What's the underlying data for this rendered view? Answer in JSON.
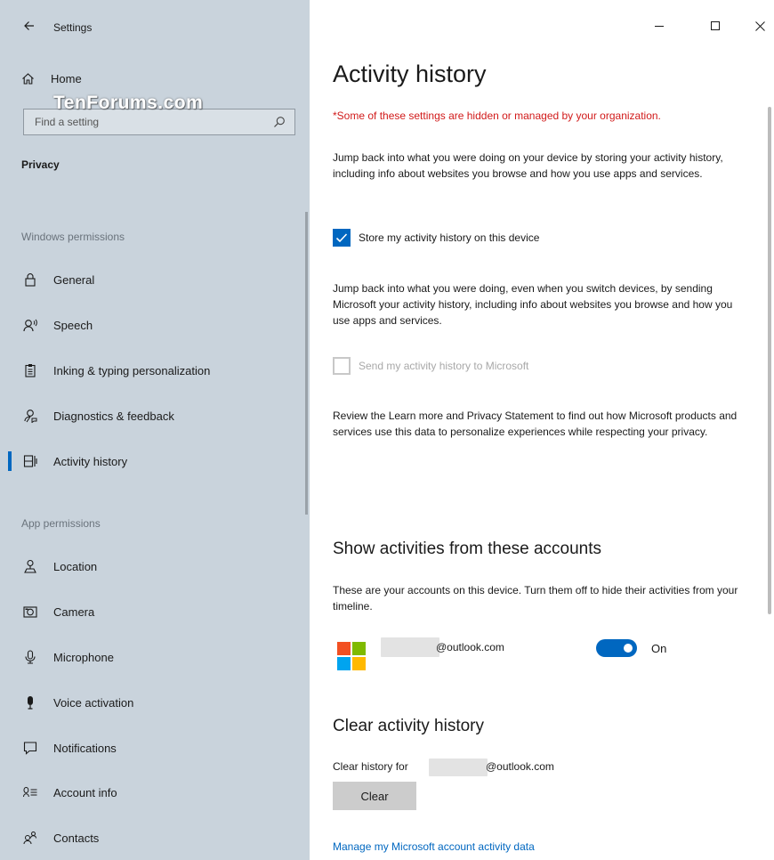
{
  "window": {
    "title": "Settings",
    "watermark": "TenForums.com",
    "controls": {
      "minimize": "–",
      "maximize": "☐",
      "close": "✕"
    }
  },
  "sidebar": {
    "home_label": "Home",
    "search": {
      "placeholder": "Find a setting",
      "value": ""
    },
    "section_label": "Privacy",
    "group_windows_permissions": "Windows permissions",
    "windows_items": [
      {
        "label": "General",
        "icon": "lock-icon"
      },
      {
        "label": "Speech",
        "icon": "speech-icon"
      },
      {
        "label": "Inking & typing personalization",
        "icon": "clipboard-icon"
      },
      {
        "label": "Diagnostics & feedback",
        "icon": "feedback-icon"
      },
      {
        "label": "Activity history",
        "icon": "timeline-icon",
        "selected": true
      }
    ],
    "group_app_permissions": "App permissions",
    "app_items": [
      {
        "label": "Location",
        "icon": "location-icon"
      },
      {
        "label": "Camera",
        "icon": "camera-icon"
      },
      {
        "label": "Microphone",
        "icon": "microphone-icon"
      },
      {
        "label": "Voice activation",
        "icon": "voice-activation-icon"
      },
      {
        "label": "Notifications",
        "icon": "notification-icon"
      },
      {
        "label": "Account info",
        "icon": "account-info-icon"
      },
      {
        "label": "Contacts",
        "icon": "contacts-icon"
      }
    ]
  },
  "main": {
    "title": "Activity history",
    "managed_warning": "*Some of these settings are hidden or managed by your organization.",
    "intro_text": "Jump back into what you were doing on your device by storing your activity history, including info about websites you browse and how you use apps and services.",
    "store_checkbox": {
      "label": "Store my activity history on this device",
      "checked": true
    },
    "send_text": "Jump back into what you were doing, even when you switch devices, by sending Microsoft your activity history, including info about websites you browse and how you use apps and services.",
    "send_checkbox": {
      "label": "Send my activity history to Microsoft",
      "checked": false,
      "disabled": true
    },
    "review_text": "Review the Learn more and Privacy Statement to find out how Microsoft products and services use this data to personalize experiences while respecting your privacy.",
    "accounts_section": {
      "title": "Show activities from these accounts",
      "description": "These are your accounts on this device. Turn them off to hide their activities from your timeline.",
      "account_email": "@outlook.com",
      "toggle_state": "On"
    },
    "clear_section": {
      "title": "Clear activity history",
      "clear_for_label": "Clear history for",
      "account_email": "@outlook.com",
      "button_label": "Clear"
    },
    "manage_link": "Manage my Microsoft account activity data"
  },
  "colors": {
    "accent": "#0067c0",
    "sidebar_bg": "#c9d3dc",
    "warning_red": "#d11a1a",
    "ms_logo": [
      "#f25022",
      "#7fba00",
      "#00a4ef",
      "#ffb900"
    ]
  }
}
